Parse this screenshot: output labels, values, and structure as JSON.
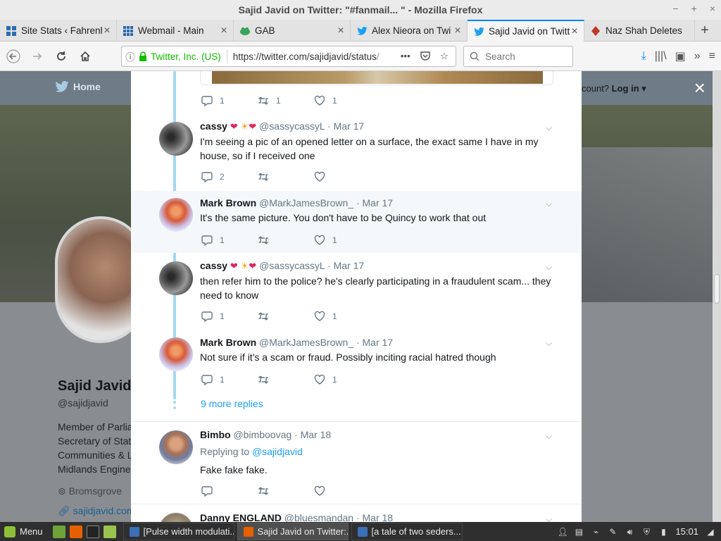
{
  "window": {
    "title": "Sajid Javid on Twitter: \"#fanmail... \" - Mozilla Firefox",
    "controls": [
      "−",
      "+",
      "×"
    ]
  },
  "tabs": [
    {
      "label": "Site Stats ‹ Fahrenh",
      "icon": "grid-icon",
      "close": "×"
    },
    {
      "label": "Webmail - Main",
      "icon": "grid-icon",
      "close": "×"
    },
    {
      "label": "GAB",
      "icon": "frog-icon",
      "close": "×"
    },
    {
      "label": "Alex Nieora on Twi",
      "icon": "twitter-bird-icon",
      "close": "×"
    },
    {
      "label": "Sajid Javid on Twitte",
      "icon": "twitter-bird-icon",
      "close": "×",
      "active": true
    },
    {
      "label": "Naz Shah Deletes",
      "icon": "site-icon",
      "close": "×"
    }
  ],
  "newtab": "+",
  "nav": {
    "identity": "Twitter, Inc. (US)",
    "url": "https://twitter.com/sajidjavid/status",
    "url_faded": "/",
    "more": "•••",
    "search_placeholder": "Search"
  },
  "twitter": {
    "home": "Home",
    "account_prompt": "count?",
    "login": "Log in ▾",
    "close": "×"
  },
  "profile": {
    "name": "Sajid Javid",
    "handle": "@sajidjavid",
    "bio_lines": [
      "Member of Parlia",
      "Secretary of Stat",
      "Communities & L",
      "Midlands Engine"
    ],
    "location": "Bromsgrove",
    "link": "sajidjavid.com"
  },
  "thread": {
    "top_tweet_counts": {
      "replies": "1",
      "retweets": "1",
      "likes": "1"
    },
    "tweets": [
      {
        "name": "cassy",
        "badges": [
          "❤",
          "☀",
          "❤"
        ],
        "handle": "@sassycassyL",
        "date": "· Mar 17",
        "text": "I'm seeing a pic of an opened letter on a surface, the exact same I have in my house, so if I received one",
        "replies": "2",
        "retweets": "",
        "likes": ""
      },
      {
        "name": "Mark Brown",
        "badges": [],
        "handle": "@MarkJamesBrown_",
        "date": "· Mar 17",
        "text": "It's the same picture. You don't have to be Quincy to work that out",
        "replies": "1",
        "retweets": "",
        "likes": "1"
      },
      {
        "name": "cassy",
        "badges": [
          "❤",
          "☀",
          "❤"
        ],
        "handle": "@sassycassyL",
        "date": "· Mar 17",
        "text": "then refer him to the police? he's clearly participating in a fraudulent scam... they need to know",
        "replies": "1",
        "retweets": "",
        "likes": "1"
      },
      {
        "name": "Mark Brown",
        "badges": [],
        "handle": "@MarkJamesBrown_",
        "date": "· Mar 17",
        "text": "Not sure if it's a scam or fraud. Possibly inciting racial hatred though",
        "replies": "1",
        "retweets": "",
        "likes": "1"
      }
    ],
    "more_replies": "9 more replies",
    "bimbo": {
      "name": "Bimbo",
      "handle": "@bimboovag",
      "date": "· Mar 18",
      "replying_prefix": "Replying to",
      "replying_to": "@sajidjavid",
      "text": "Fake fake fake."
    },
    "danny": {
      "name": "Danny ENGLAND",
      "handle": "@bluesmandan",
      "date": "· Mar 18"
    }
  },
  "taskbar": {
    "menu": "Menu",
    "tasks": [
      {
        "label": "[Pulse width modulati..."
      },
      {
        "label": "Sajid Javid on Twitter:...",
        "active": true
      },
      {
        "label": "[a tale of two seders...."
      }
    ],
    "clock": "15:01"
  }
}
